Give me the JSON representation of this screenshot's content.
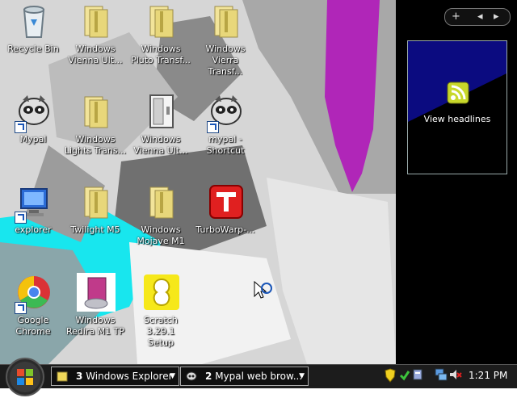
{
  "desktop_icons": [
    {
      "label": "Recycle Bin",
      "icon": "recycle-bin-icon"
    },
    {
      "label": "Windows\nVienna Ult...",
      "icon": "folder-icon"
    },
    {
      "label": "Windows\nPluto Transf...",
      "icon": "folder-icon"
    },
    {
      "label": "Windows\nVierra Transf...",
      "icon": "folder-icon"
    },
    {
      "label": "Mypal",
      "icon": "mypal-icon"
    },
    {
      "label": "Windows\nLights Trans...",
      "icon": "folder-icon"
    },
    {
      "label": "Windows\nVienna Ult...",
      "icon": "door-icon"
    },
    {
      "label": "mypal -\nShortcut",
      "icon": "mypal-icon"
    },
    {
      "label": "explorer",
      "icon": "explorer-icon"
    },
    {
      "label": "Twilight M5",
      "icon": "folder-icon"
    },
    {
      "label": "Windows\nMojave M1",
      "icon": "folder-icon"
    },
    {
      "label": "TurboWarp-...",
      "icon": "turbowarp-icon"
    },
    {
      "label": "Google\nChrome",
      "icon": "chrome-icon"
    },
    {
      "label": "Windows\nRedira M1 TP",
      "icon": "installer-icon"
    },
    {
      "label": "Scratch 3.29.1\nSetup",
      "icon": "scratch-setup-icon"
    }
  ],
  "sidebar": {
    "controls": {
      "add": "+",
      "prev": "◂",
      "next": "▸"
    },
    "gadget_label": "View headlines"
  },
  "taskbar": {
    "buttons": [
      {
        "count": "3",
        "label": "Windows Explorer"
      },
      {
        "count": "2",
        "label": "Mypal web brow..."
      }
    ],
    "clock": "1:21 PM"
  },
  "colors": {
    "accent_magenta": "#b026b8",
    "accent_cyan": "#18e6ee",
    "gadget_bg": "#0b0b80",
    "taskbar_bg": "#1c1c1c"
  }
}
